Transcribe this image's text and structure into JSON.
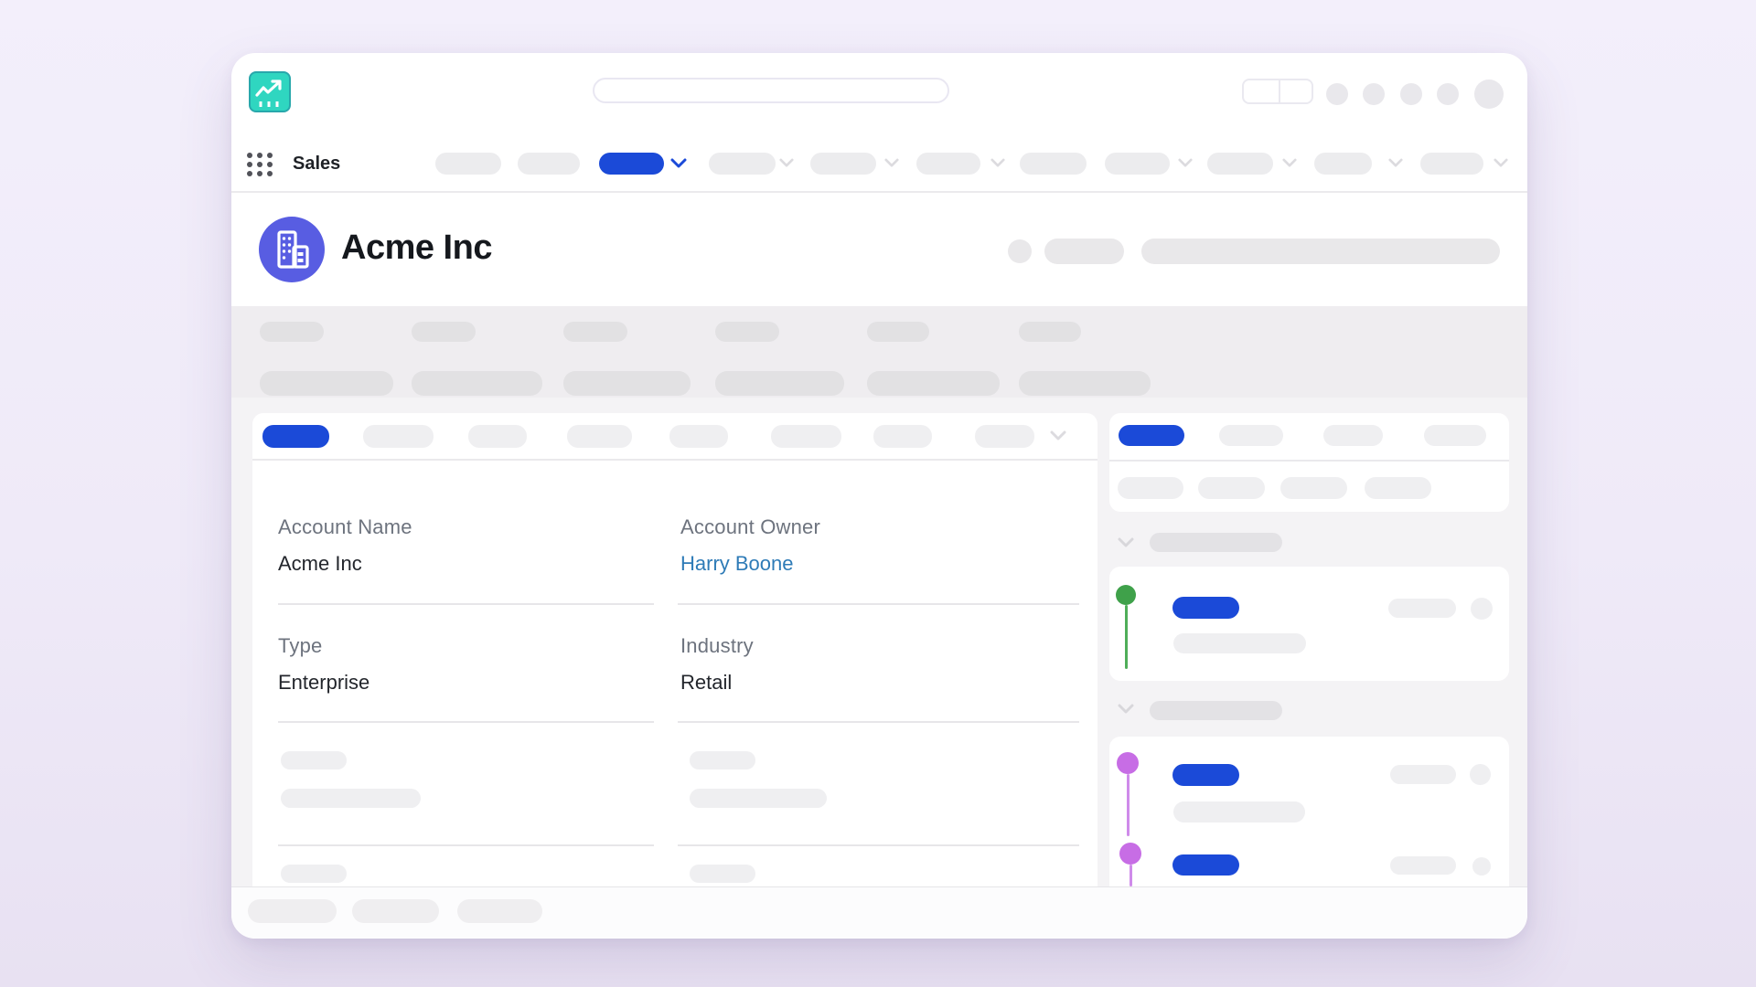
{
  "app": {
    "name": "Sales",
    "logo_icon": "trend-chart-icon",
    "launcher_icon": "waffle-grid-icon"
  },
  "record": {
    "title": "Acme Inc",
    "entity_icon": "building-icon"
  },
  "details": {
    "fields": [
      {
        "label": "Account Name",
        "value": "Acme Inc",
        "value_type": "text"
      },
      {
        "label": "Account Owner",
        "value": "Harry Boone",
        "value_type": "link"
      },
      {
        "label": "Type",
        "value": "Enterprise",
        "value_type": "text"
      },
      {
        "label": "Industry",
        "value": "Retail",
        "value_type": "text"
      }
    ]
  },
  "colors": {
    "accent_blue": "#1b4ad8",
    "link_blue": "#2e7bb7",
    "avatar_indigo": "#585de2",
    "logo_teal": "#2fd6c0",
    "logo_teal_border": "#28a7ab",
    "timeline_green": "#3fa14a",
    "timeline_purple": "#c76de5",
    "band_gray": "#efedf0",
    "main_gray": "#f4f3f5"
  }
}
